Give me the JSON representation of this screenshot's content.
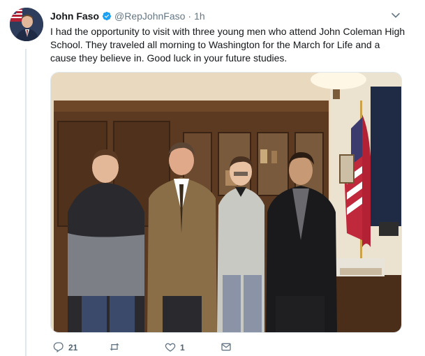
{
  "tweet": {
    "display_name": "John Faso",
    "handle": "@RepJohnFaso",
    "separator": "·",
    "time": "1h",
    "text": "I had the opportunity to visit with three young men who attend John Coleman High School. They traveled all morning to Washington for the March for Life and a cause they believe in. Good luck in your future studies."
  },
  "actions": {
    "replies_count": "21",
    "retweets_count": "",
    "likes_count": "1"
  },
  "icons": {
    "verified": "verified-badge-icon",
    "caret": "chevron-down-icon",
    "reply": "reply-icon",
    "retweet": "retweet-icon",
    "like": "heart-icon",
    "dm": "envelope-icon"
  },
  "colors": {
    "verified_blue": "#1da1f2",
    "text_primary": "#14171a",
    "text_secondary": "#657786",
    "divider": "#e1e8ed"
  }
}
